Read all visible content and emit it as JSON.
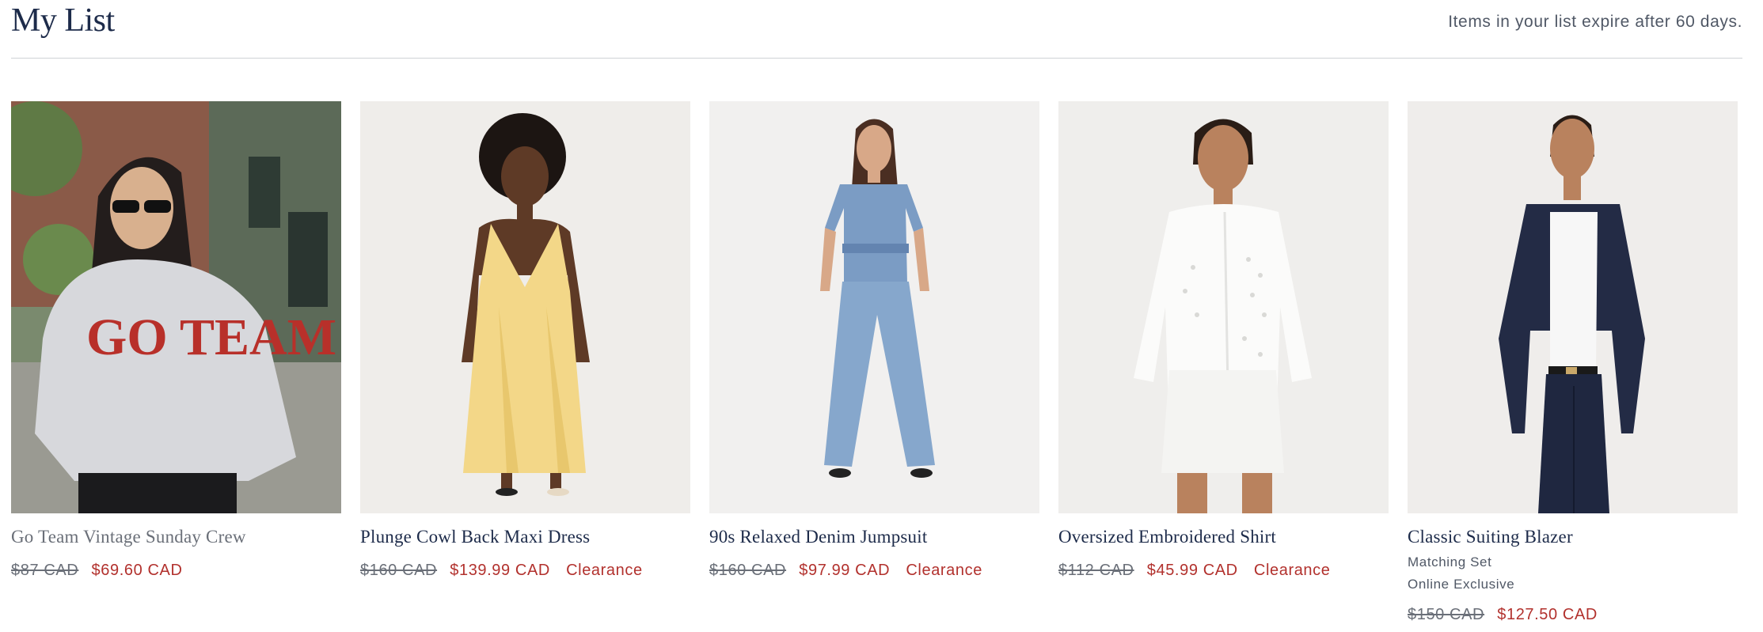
{
  "header": {
    "title": "My List",
    "note": "Items in your list expire after 60 days."
  },
  "products": [
    {
      "name": "Go Team Vintage Sunday Crew",
      "original_price": "$87 CAD",
      "sale_price": "$69.60 CAD",
      "badge": "",
      "image": "gray sweatshirt with red GO TEAM lettering, street backdrop",
      "graphic_text": "GO TEAM"
    },
    {
      "name": "Plunge Cowl Back Maxi Dress",
      "original_price": "$160 CAD",
      "sale_price": "$139.99 CAD",
      "badge": "Clearance",
      "image": "yellow satin maxi dress"
    },
    {
      "name": "90s Relaxed Denim Jumpsuit",
      "original_price": "$160 CAD",
      "sale_price": "$97.99 CAD",
      "badge": "Clearance",
      "image": "light wash denim jumpsuit"
    },
    {
      "name": "Oversized Embroidered Shirt",
      "original_price": "$112 CAD",
      "sale_price": "$45.99 CAD",
      "badge": "Clearance",
      "image": "white eyelet shirt with white denim shorts"
    },
    {
      "name": "Classic Suiting Blazer",
      "meta": [
        "Matching Set",
        "Online Exclusive"
      ],
      "original_price": "$150 CAD",
      "sale_price": "$127.50 CAD",
      "badge": "",
      "image": "navy blazer with white tank and navy trousers"
    }
  ],
  "colors": {
    "sale": "#b2312d",
    "title": "#1d2b4a",
    "muted": "#6a6f78"
  }
}
